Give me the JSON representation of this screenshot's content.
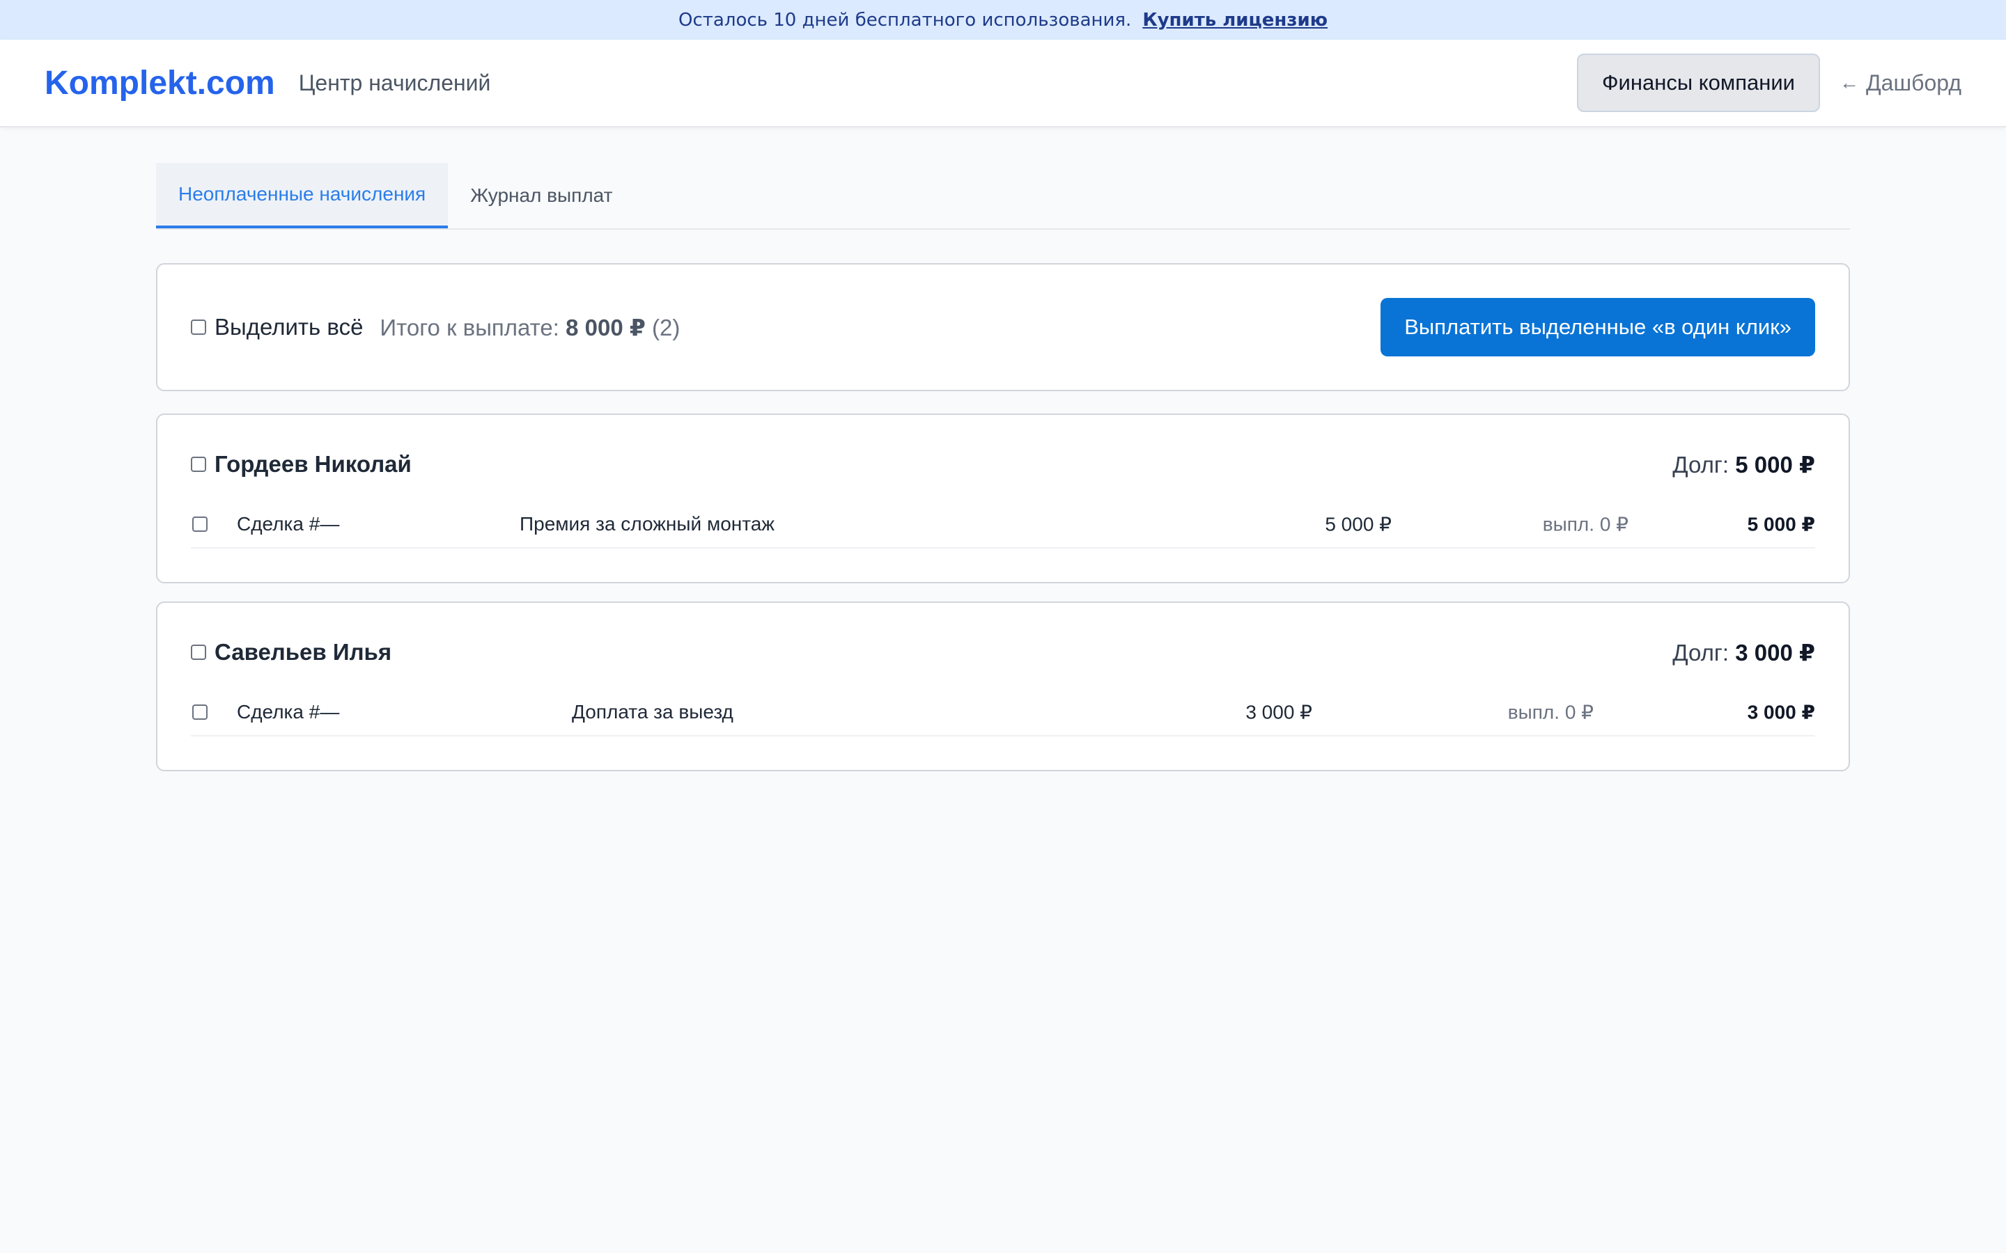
{
  "banner": {
    "text": "Осталось 10 дней бесплатного использования.",
    "link": "Купить лицензию"
  },
  "header": {
    "logo": "Komplekt.com",
    "subtitle": "Центр начислений",
    "finance_button": "Финансы компании",
    "back_arrow": "←",
    "back_label": "Дашборд"
  },
  "tabs": [
    {
      "label": "Неоплаченные начисления",
      "active": true
    },
    {
      "label": "Журнал выплат",
      "active": false
    }
  ],
  "toolbar": {
    "select_all_label": "Выделить всё",
    "total_label": "Итого к выплате:",
    "total_amount": "8 000 ₽",
    "total_count": "(2)",
    "pay_button": "Выплатить выделенные «в один клик»"
  },
  "employees": [
    {
      "name": "Гордеев Николай",
      "debt_label": "Долг:",
      "debt_amount": "5 000 ₽",
      "rows": [
        {
          "deal": "Сделка #—",
          "description": "Премия за сложный монтаж",
          "amount": "5 000 ₽",
          "paid": "выпл. 0 ₽",
          "remaining": "5 000 ₽"
        }
      ]
    },
    {
      "name": "Савельев Илья",
      "debt_label": "Долг:",
      "debt_amount": "3 000 ₽",
      "rows": [
        {
          "deal": "Сделка #—",
          "description": "Доплата за выезд",
          "amount": "3 000 ₽",
          "paid": "выпл. 0 ₽",
          "remaining": "3 000 ₽"
        }
      ]
    }
  ],
  "colors": {
    "accent": "#2563eb",
    "primary_button": "#0a74d6",
    "banner_bg": "#dbeafe",
    "active_tab": "#2b7de9"
  }
}
